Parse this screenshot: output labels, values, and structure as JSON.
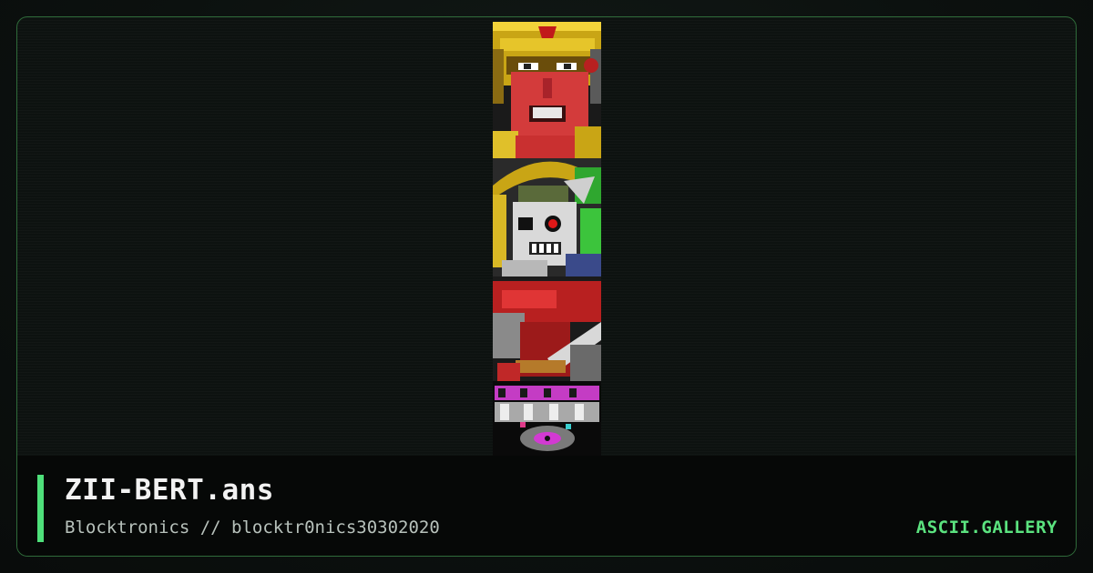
{
  "card": {
    "title": "ZII-BERT.ans",
    "subtitle": "Blocktronics // blocktr0nics30302020",
    "brand": "ASCII.GALLERY"
  },
  "artwork": {
    "description_icon": "ansi-art-icon",
    "scenes": [
      "warrior-helmet",
      "skull-shield",
      "red-creature-blade",
      "logo-lettering"
    ]
  },
  "colors": {
    "accent": "#4ee07a",
    "brand": "#5be37f",
    "frame_border": "#2f6b3a",
    "footer_bg": "#060807",
    "title_text": "#f2f2f2",
    "subtitle_text": "#b7c1bb"
  }
}
